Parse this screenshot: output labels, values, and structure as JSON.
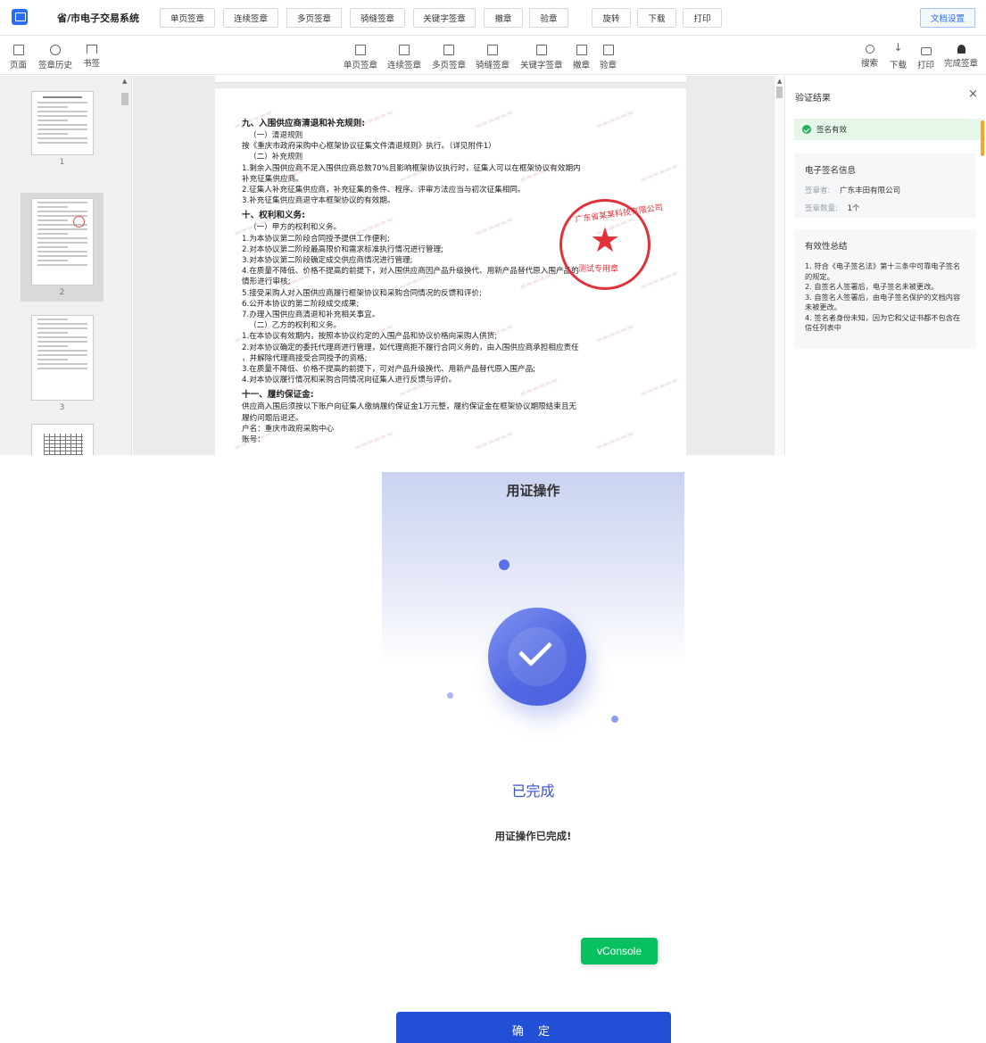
{
  "app": {
    "title": "省/市电子交易系统",
    "top_buttons": [
      "单页签章",
      "连续签章",
      "多页签章",
      "骑缝签章",
      "关键字签章",
      "撤章",
      "验章",
      "旋转",
      "下载",
      "打印"
    ],
    "doc_settings": "文档设置"
  },
  "toolbar": {
    "left": [
      {
        "label": "页面",
        "icon": "page-icon"
      },
      {
        "label": "签章历史",
        "icon": "history-icon"
      },
      {
        "label": "书签",
        "icon": "bookmark-icon"
      }
    ],
    "center": [
      {
        "label": "单页签章",
        "icon": "single-sign-icon"
      },
      {
        "label": "连续签章",
        "icon": "continuous-sign-icon"
      },
      {
        "label": "多页签章",
        "icon": "multi-sign-icon"
      },
      {
        "label": "骑缝签章",
        "icon": "seam-sign-icon"
      },
      {
        "label": "关键字签章",
        "icon": "keyword-sign-icon"
      },
      {
        "label": "撤章",
        "icon": "revoke-icon"
      },
      {
        "label": "验章",
        "icon": "verify-icon"
      }
    ],
    "right": [
      {
        "label": "搜索",
        "icon": "search-icon"
      },
      {
        "label": "下载",
        "icon": "download-icon"
      },
      {
        "label": "打印",
        "icon": "print-icon"
      },
      {
        "label": "完成签章",
        "icon": "stamp-icon"
      }
    ]
  },
  "thumbnails": [
    {
      "page": "1",
      "active": false
    },
    {
      "page": "2",
      "active": true
    },
    {
      "page": "3",
      "active": false
    }
  ],
  "document": {
    "lines": [
      {
        "text": "九、入围供应商清退和补充规则:",
        "type": "h"
      },
      {
        "text": "（一）清退规则",
        "type": "i"
      },
      {
        "text": "按《重庆市政府采购中心框架协议征集文件清退规则》执行。（详见附件1）",
        "type": "p"
      },
      {
        "text": "（二）补充规则",
        "type": "i"
      },
      {
        "text": "1.剩余入围供应商不足入围供应商总数70%且影响框架协议执行时，征集人可以在框架协议有效期内",
        "type": "p"
      },
      {
        "text": "补充征集供应商。",
        "type": "p"
      },
      {
        "text": "2.征集人补充征集供应商，补充征集的条件、程序、评审方法应当与初次征集相同。",
        "type": "p"
      },
      {
        "text": "3.补充征集供应商退守本框架协议的有效期。",
        "type": "p"
      },
      {
        "text": "十、权利和义务:",
        "type": "h"
      },
      {
        "text": "（一）甲方的权利和义务。",
        "type": "i"
      },
      {
        "text": "1.为本协议第二阶段合同授予提供工作便利;",
        "type": "p"
      },
      {
        "text": "2.对本协议第二阶段最高限价和需求标准执行情况进行管理;",
        "type": "p"
      },
      {
        "text": "3.对本协议第二阶段确定成交供应商情况进行管理;",
        "type": "p"
      },
      {
        "text": "4.在质量不降低、价格不提高的前提下，对入围供应商因产品升级换代、用新产品替代原入围产品的",
        "type": "p"
      },
      {
        "text": "情形进行审核;",
        "type": "p"
      },
      {
        "text": "5.接受采购人对入围供应商履行框架协议和采购合同情况的反馈和评价;",
        "type": "p"
      },
      {
        "text": "6.公开本协议的第二阶段成交成果;",
        "type": "p"
      },
      {
        "text": "7.办理入围供应商清退和补充相关事宜。",
        "type": "p"
      },
      {
        "text": "（二）乙方的权利和义务。",
        "type": "i"
      },
      {
        "text": "1.在本协议有效期内，按照本协议约定的入围产品和协议价格向采购人供货;",
        "type": "p"
      },
      {
        "text": "2.对本协议确定的委托代理商进行管理，如代理商拒不履行合同义务的，由入围供应商承担相应责任",
        "type": "p"
      },
      {
        "text": "，并解除代理商接受合同授予的资格;",
        "type": "p"
      },
      {
        "text": "3.在质量不降低、价格不提高的前提下，可对产品升级换代、用新产品替代原入围产品;",
        "type": "p"
      },
      {
        "text": "4.对本协议履行情况和采购合同情况向征集人进行反馈与评价。",
        "type": "p"
      },
      {
        "text": "十一、履约保证金:",
        "type": "h"
      },
      {
        "text": "供应商入围后须按以下账户向征集人缴纳履约保证金1万元整，履约保证金在框架协议期限结束且无",
        "type": "p"
      },
      {
        "text": "履约问题后退还。",
        "type": "p"
      },
      {
        "text": "户名：重庆市政府采购中心",
        "type": "p"
      },
      {
        "text": "账号：",
        "type": "p"
      }
    ],
    "seal": {
      "arc_text": "广东省某某科技有限公司",
      "bottom_text": "测试专用章",
      "color": "#e3313a"
    }
  },
  "panel": {
    "title": "验证结果",
    "status": "签名有效",
    "info_title": "电子签名信息",
    "signer_label": "签章者:",
    "signer_value": "广东丰田有限公司",
    "count_label": "签章数量:",
    "count_value": "1个",
    "summary_title": "有效性总结",
    "summary_lines": [
      "1. 符合《电子签名法》第十三条中可靠电子签名",
      "的规定。",
      "2. 自签名人签署后，电子签名未被更改。",
      "3. 自签名人签署后，由电子签名保护的文档内容",
      "未被更改。",
      "4. 签名者身份未知，因为它和父证书都不包含在",
      "信任列表中"
    ]
  },
  "phone": {
    "title": "用证操作",
    "status": "已完成",
    "message": "用证操作已完成!",
    "vconsole": "vConsole",
    "confirm": "确 定",
    "accent": "#2150d6"
  }
}
